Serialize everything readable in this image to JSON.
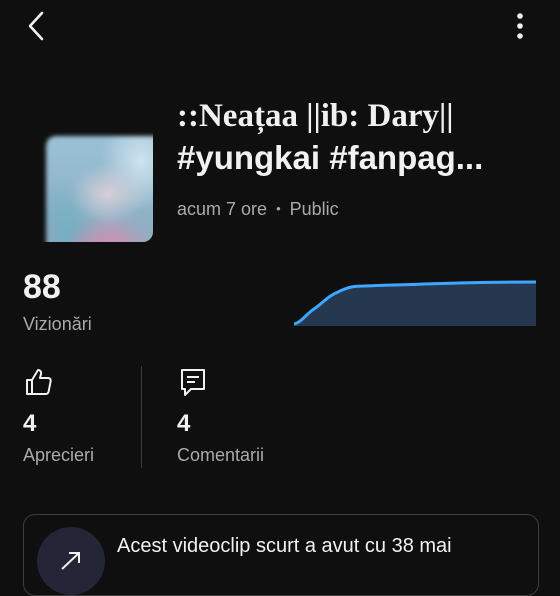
{
  "header": {
    "back_icon": "chevron-left-icon",
    "more_icon": "more-vert-icon"
  },
  "video": {
    "title_line1": "::Neațaa ||ib: Dary||",
    "title_line2": "#yungkai #fanpag...",
    "time_ago": "acum 7 ore",
    "separator": "•",
    "visibility": "Public"
  },
  "views": {
    "count": "88",
    "label": "Vizionări"
  },
  "stats": {
    "likes": {
      "icon": "thumb-up-icon",
      "count": "4",
      "label": "Aprecieri"
    },
    "comments": {
      "icon": "comment-icon",
      "count": "4",
      "label": "Comentarii"
    }
  },
  "insight": {
    "icon": "trending-up-icon",
    "text": "Acest videoclip scurt a avut cu 38 mai"
  },
  "colors": {
    "background": "#0f0f0f",
    "accent_line": "#3ea6ff",
    "chart_fill": "#263850",
    "text_primary": "#f1f1f1",
    "text_secondary": "#aaaaaa"
  }
}
